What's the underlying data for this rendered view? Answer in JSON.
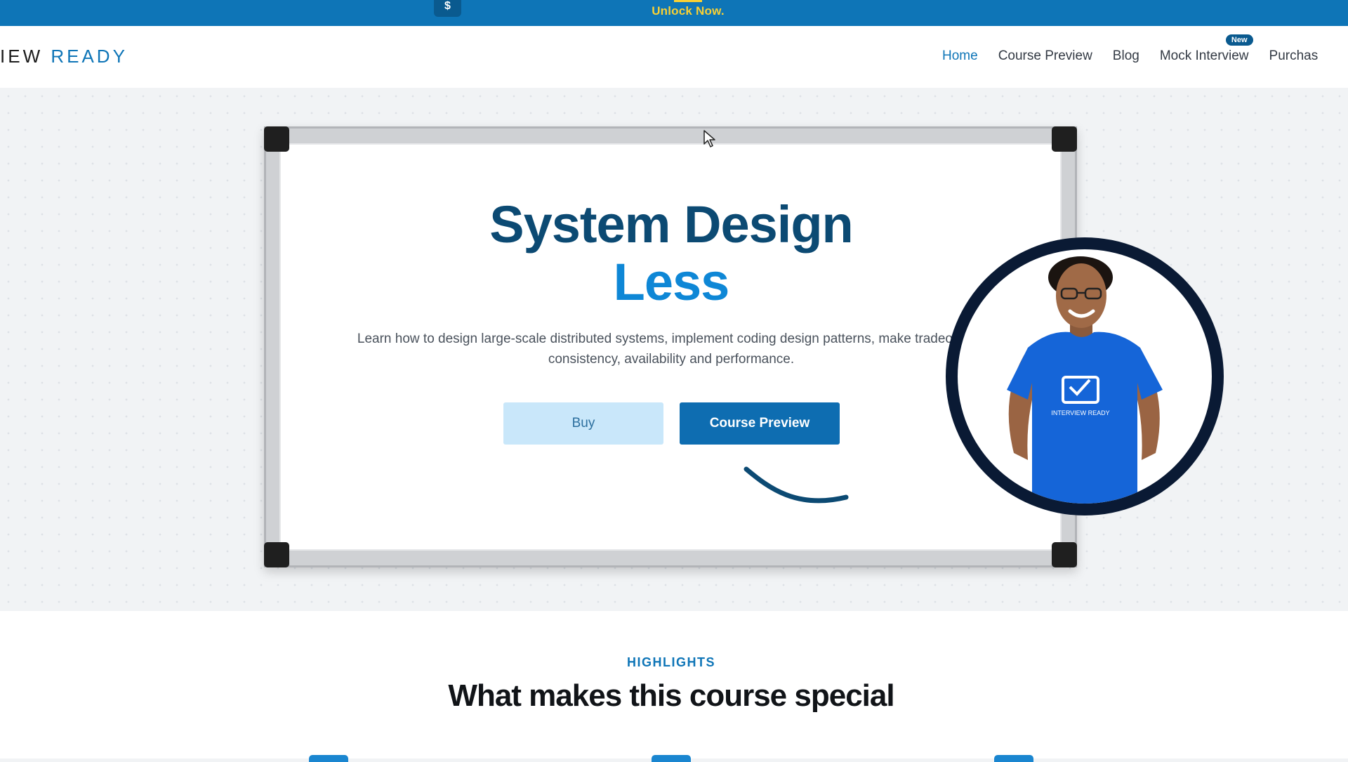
{
  "banner": {
    "chip_icon": "dollar-icon",
    "unlock_text": "Unlock Now."
  },
  "nav": {
    "logo_text": "IEW ",
    "logo_accent": "READY",
    "links": [
      {
        "label": "Home",
        "active": true
      },
      {
        "label": "Course Preview",
        "active": false
      },
      {
        "label": "Blog",
        "active": false
      },
      {
        "label": "Mock Interview",
        "active": false,
        "badge": "New"
      },
      {
        "label": "Purchas",
        "active": false
      }
    ]
  },
  "hero": {
    "title": "System Design",
    "title_accent": "Less",
    "description": "Learn how to design large-scale distributed systems, implement coding design patterns, make tradeoffs on consistency, availability and performance.",
    "buy_label": "Buy",
    "preview_label": "Course Preview",
    "shirt_text": "INTERVIEW READY"
  },
  "highlights": {
    "kicker": "HIGHLIGHTS",
    "title": "What makes this course special"
  },
  "colors": {
    "brand_blue": "#0e75b7",
    "accent_yellow": "#f8d034",
    "title_navy": "#0c4a73",
    "title_light": "#0e87d6"
  }
}
